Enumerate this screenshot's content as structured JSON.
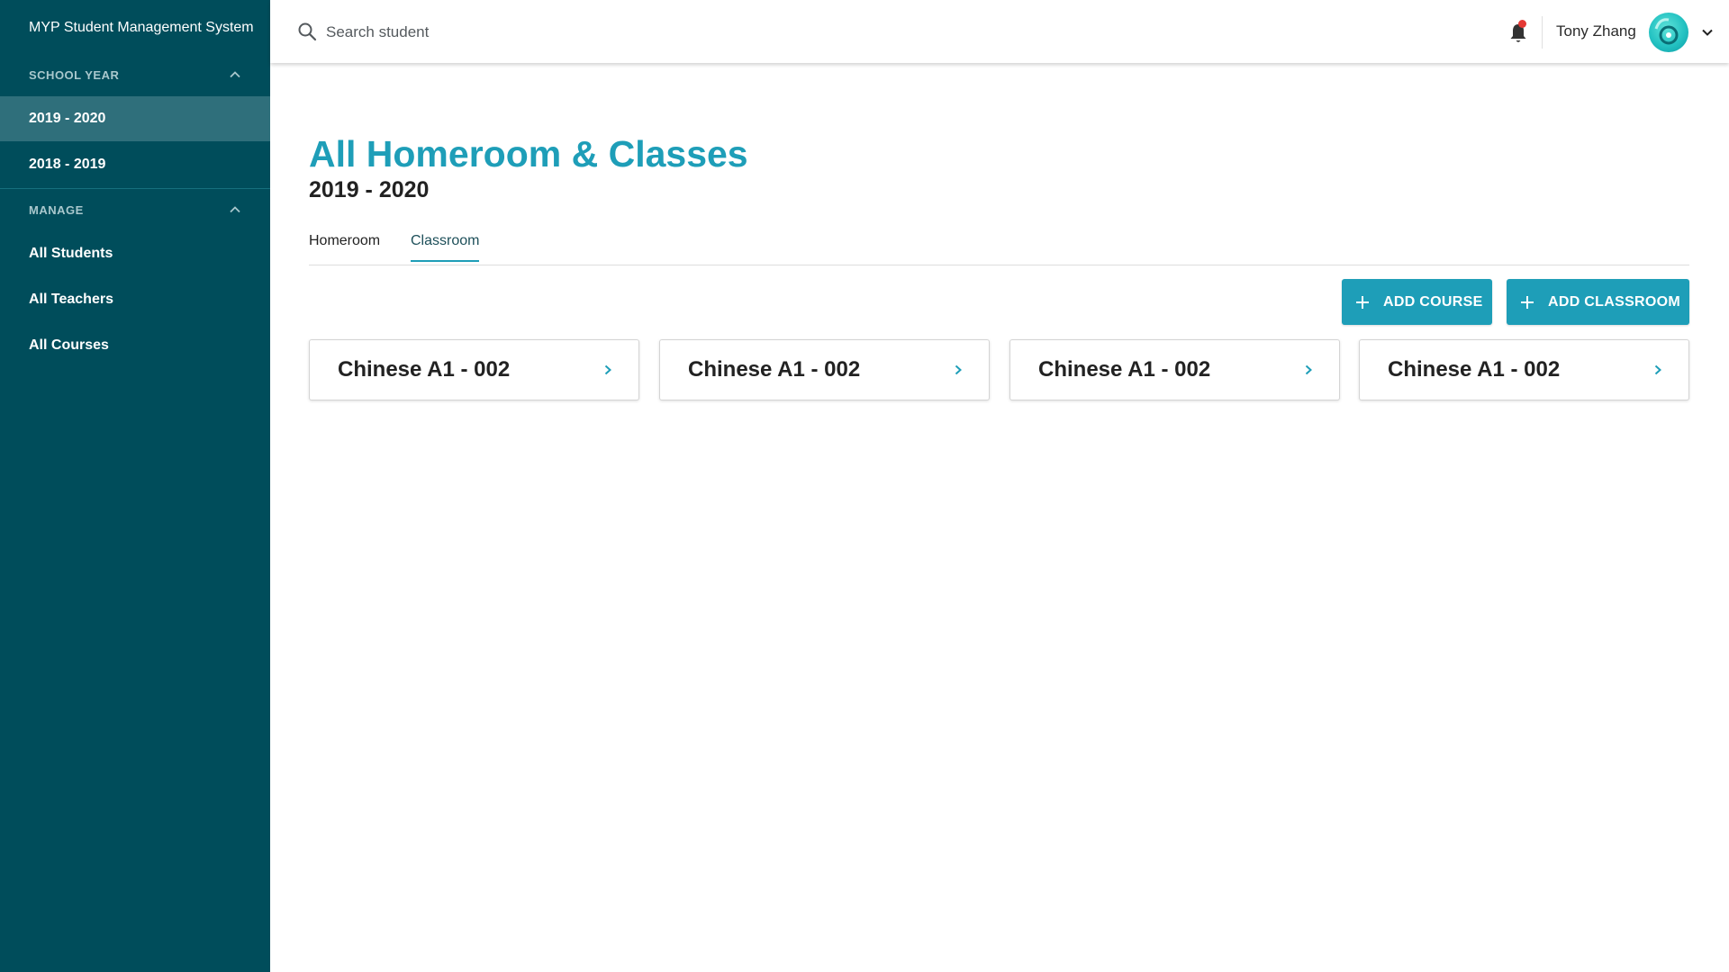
{
  "sidebar": {
    "app_title": "MYP Student Management System",
    "school_year_header": "SCHOOL YEAR",
    "years": [
      {
        "label": "2019 - 2020",
        "active": true
      },
      {
        "label": "2018 - 2019",
        "active": false
      }
    ],
    "manage_header": "MANAGE",
    "manage_items": [
      {
        "label": "All Students"
      },
      {
        "label": "All Teachers"
      },
      {
        "label": "All Courses"
      }
    ]
  },
  "topbar": {
    "search_placeholder": "Search student",
    "user_name": "Tony Zhang",
    "notification_dot_color": "#e53935"
  },
  "main": {
    "title": "All Homeroom & Classes",
    "subtitle": "2019 - 2020",
    "tabs": [
      {
        "label": "Homeroom",
        "active": false
      },
      {
        "label": "Classroom",
        "active": true
      }
    ],
    "actions": {
      "add_course": "ADD COURSE",
      "add_classroom": "ADD CLASSROOM"
    },
    "cards": [
      {
        "title": "Chinese A1 - 002"
      },
      {
        "title": "Chinese A1 - 002"
      },
      {
        "title": "Chinese A1 - 002"
      },
      {
        "title": "Chinese A1 - 002"
      }
    ]
  },
  "colors": {
    "sidebar_bg": "#004d5b",
    "sidebar_active": "#2f6f7b",
    "accent": "#1e9eb8"
  },
  "icons": {
    "search": "search-icon",
    "bell": "bell-icon",
    "chevron_up": "chevron-up-icon",
    "chevron_down": "chevron-down-icon",
    "chevron_right": "chevron-right-icon",
    "plus": "plus-icon",
    "avatar": "avatar"
  }
}
